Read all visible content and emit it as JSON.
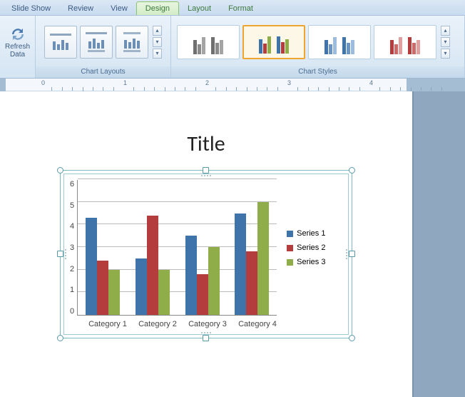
{
  "tabs": {
    "slideshow": "Slide Show",
    "review": "Review",
    "view": "View",
    "design": "Design",
    "layout": "Layout",
    "format": "Format"
  },
  "ribbon": {
    "refresh_label": "Refresh Data",
    "chart_layouts_label": "Chart Layouts",
    "chart_styles_label": "Chart Styles"
  },
  "slide": {
    "title": "Title"
  },
  "colors": {
    "series1": "#3e74aa",
    "series2": "#b43c3c",
    "series3": "#8fae4a",
    "gray1": "#6f6f6f",
    "gray2": "#8a8a8a",
    "gray3": "#a4a4a4"
  },
  "chart_data": {
    "type": "bar",
    "title": "",
    "xlabel": "",
    "ylabel": "",
    "ylim": [
      0,
      6
    ],
    "yticks": [
      0,
      1,
      2,
      3,
      4,
      5,
      6
    ],
    "categories": [
      "Category 1",
      "Category 2",
      "Category 3",
      "Category 4"
    ],
    "series": [
      {
        "name": "Series 1",
        "values": [
          4.3,
          2.5,
          3.5,
          4.5
        ]
      },
      {
        "name": "Series 2",
        "values": [
          2.4,
          4.4,
          1.8,
          2.8
        ]
      },
      {
        "name": "Series 3",
        "values": [
          2.0,
          2.0,
          3.0,
          5.0
        ]
      }
    ],
    "legend_position": "right",
    "grid": true
  },
  "ruler": {
    "marks": [
      0,
      1,
      2,
      3,
      4
    ]
  }
}
